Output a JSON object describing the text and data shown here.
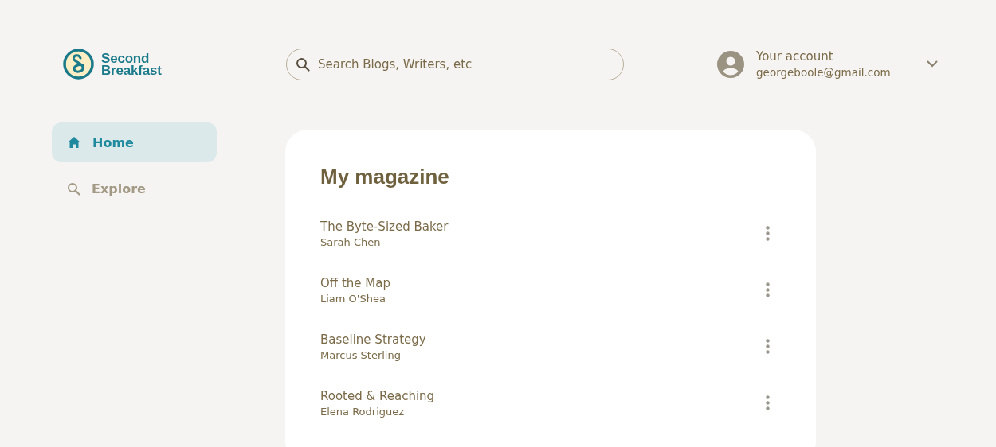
{
  "logo": {
    "line_1": "Second",
    "line_2": "Breakfast"
  },
  "search": {
    "placeholder": "Search Blogs, Writers, etc"
  },
  "account": {
    "title": "Your account",
    "email": "georgeboole@gmail.com"
  },
  "sidebar": {
    "items": [
      {
        "label": "Home",
        "kind": "home",
        "selected": true
      },
      {
        "label": "Explore",
        "kind": "search",
        "selected": false
      }
    ]
  },
  "magazine": {
    "title": "My magazine",
    "items": [
      {
        "title": "The Byte-Sized Baker",
        "author": "Sarah Chen"
      },
      {
        "title": "Off the Map",
        "author": "Liam O'Shea"
      },
      {
        "title": "Baseline Strategy",
        "author": "Marcus Sterling"
      },
      {
        "title": "Rooted & Reaching",
        "author": "Elena Rodriguez"
      }
    ]
  }
}
